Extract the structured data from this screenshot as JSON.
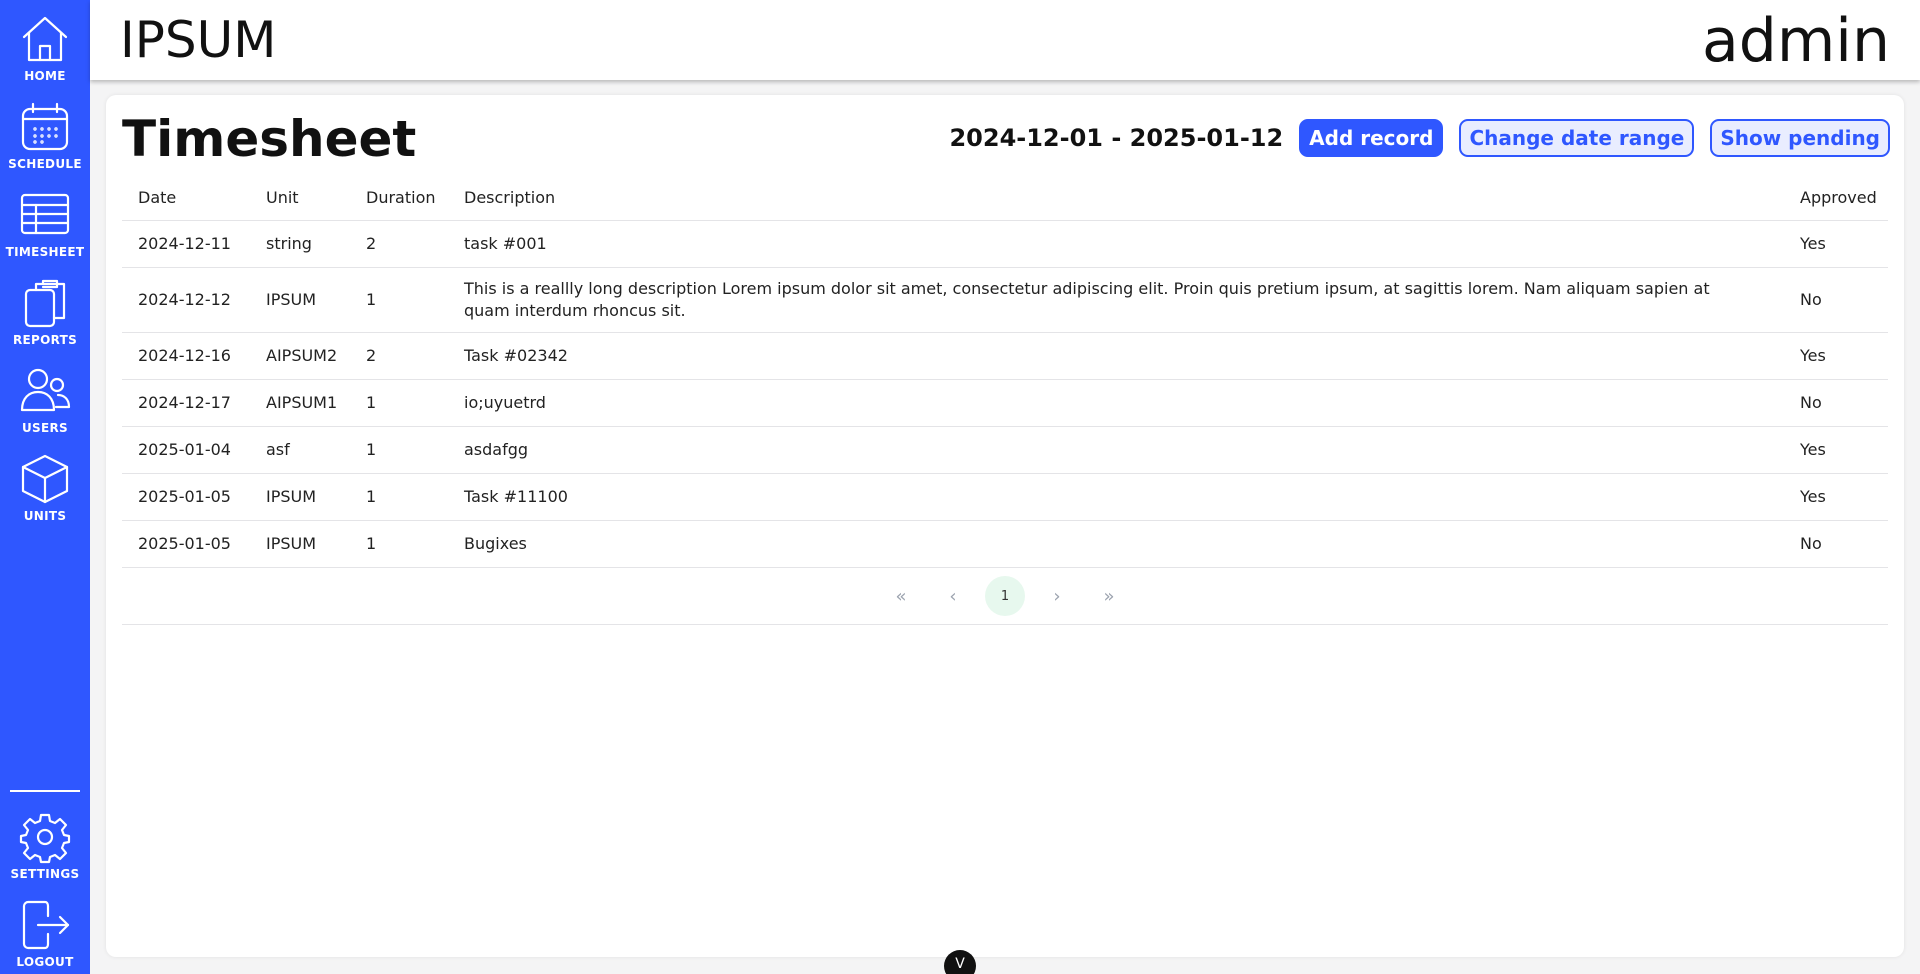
{
  "app": {
    "brand": "IPSUM",
    "user": "admin"
  },
  "sidebar": {
    "items": [
      {
        "label": "HOME",
        "icon": "home-icon"
      },
      {
        "label": "SCHEDULE",
        "icon": "calendar-icon"
      },
      {
        "label": "TIMESHEET",
        "icon": "table-icon"
      },
      {
        "label": "REPORTS",
        "icon": "clipboard-icon"
      },
      {
        "label": "USERS",
        "icon": "users-icon"
      },
      {
        "label": "UNITS",
        "icon": "cube-icon"
      }
    ],
    "bottom": [
      {
        "label": "SETTINGS",
        "icon": "gear-icon"
      },
      {
        "label": "LOGOUT",
        "icon": "logout-icon"
      }
    ]
  },
  "page": {
    "title": "Timesheet",
    "date_range": "2024-12-01 - 2025-01-12",
    "buttons": {
      "add": "Add record",
      "change_range": "Change date range",
      "pending": "Show pending"
    }
  },
  "table": {
    "headers": [
      "Date",
      "Unit",
      "Duration",
      "Description",
      "Approved"
    ],
    "rows": [
      [
        "2024-12-11",
        "string",
        "2",
        "task #001",
        "Yes"
      ],
      [
        "2024-12-12",
        "IPSUM",
        "1",
        "This is a reallly long description Lorem ipsum dolor sit amet, consectetur adipiscing elit. Proin quis pretium ipsum, at sagittis lorem. Nam aliquam sapien at quam interdum rhoncus sit.",
        "No"
      ],
      [
        "2024-12-16",
        "AIPSUM2",
        "2",
        "Task #02342",
        "Yes"
      ],
      [
        "2024-12-17",
        "AIPSUM1",
        "1",
        "io;uyuetrd",
        "No"
      ],
      [
        "2025-01-04",
        "asf",
        "1",
        "asdafgg",
        "Yes"
      ],
      [
        "2025-01-05",
        "IPSUM",
        "1",
        "Task #11100",
        "Yes"
      ],
      [
        "2025-01-05",
        "IPSUM",
        "1",
        "Bugixes",
        "No"
      ]
    ]
  },
  "pagination": {
    "first": "«",
    "prev": "‹",
    "current": "1",
    "next": "›",
    "last": "»"
  },
  "bottom_handle": "V",
  "colors": {
    "accent": "#2f57ff",
    "accent_light": "#e9edff",
    "page_active": "#e7f8ee"
  }
}
